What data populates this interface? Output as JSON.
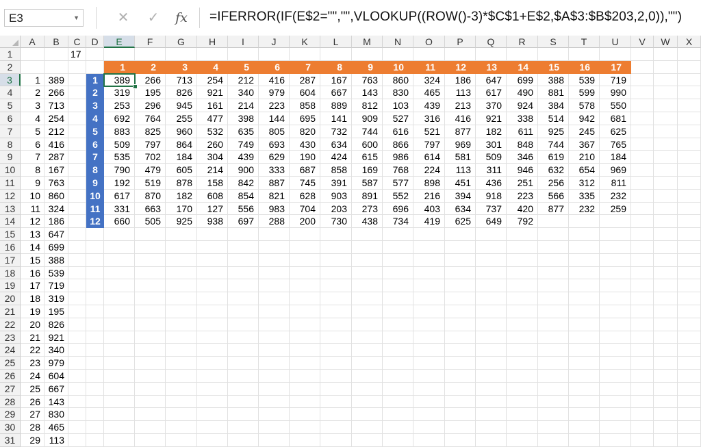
{
  "formula_bar": {
    "name_box": "E3",
    "cancel_icon": "✕",
    "enter_icon": "✓",
    "fx_label": "fx",
    "formula": "=IFERROR(IF(E$2=\"\",\"\",VLOOKUP((ROW()-3)*$C$1+E$2,$A$3:$B$203,2,0)),\"\")"
  },
  "sheet": {
    "columns": [
      "A",
      "B",
      "C",
      "D",
      "E",
      "F",
      "G",
      "H",
      "I",
      "J",
      "K",
      "L",
      "M",
      "N",
      "O",
      "P",
      "Q",
      "R",
      "S",
      "T",
      "U",
      "V",
      "W",
      "X"
    ],
    "rows": [
      1,
      2,
      3,
      4,
      5,
      6,
      7,
      8,
      9,
      10,
      11,
      12,
      13,
      14,
      15,
      16,
      17,
      18,
      19,
      20,
      21,
      22,
      23,
      24,
      25,
      26,
      27,
      28,
      29,
      30,
      31
    ],
    "selected_cell": "E3",
    "c1_value": "17",
    "col_a": [
      1,
      2,
      3,
      4,
      5,
      6,
      7,
      8,
      9,
      10,
      11,
      12,
      13,
      14,
      15,
      16,
      17,
      18,
      19,
      20,
      21,
      22,
      23,
      24,
      25,
      26,
      27,
      28,
      29
    ],
    "col_b": [
      389,
      266,
      713,
      254,
      212,
      416,
      287,
      167,
      763,
      860,
      324,
      186,
      647,
      699,
      388,
      539,
      719,
      319,
      195,
      826,
      921,
      340,
      979,
      604,
      667,
      143,
      830,
      465,
      113
    ],
    "header_row": [
      1,
      2,
      3,
      4,
      5,
      6,
      7,
      8,
      9,
      10,
      11,
      12,
      13,
      14,
      15,
      16,
      17
    ],
    "row_index": [
      1,
      2,
      3,
      4,
      5,
      6,
      7,
      8,
      9,
      10,
      11,
      12
    ],
    "matrix": [
      [
        389,
        266,
        713,
        254,
        212,
        416,
        287,
        167,
        763,
        860,
        324,
        186,
        647,
        699,
        388,
        539,
        719
      ],
      [
        319,
        195,
        826,
        921,
        340,
        979,
        604,
        667,
        143,
        830,
        465,
        113,
        617,
        490,
        881,
        599,
        990
      ],
      [
        253,
        296,
        945,
        161,
        214,
        223,
        858,
        889,
        812,
        103,
        439,
        213,
        370,
        924,
        384,
        578,
        550
      ],
      [
        692,
        764,
        255,
        477,
        398,
        144,
        695,
        141,
        909,
        527,
        316,
        416,
        921,
        338,
        514,
        942,
        681
      ],
      [
        883,
        825,
        960,
        532,
        635,
        805,
        820,
        732,
        744,
        616,
        521,
        877,
        182,
        611,
        925,
        245,
        625
      ],
      [
        509,
        797,
        864,
        260,
        749,
        693,
        430,
        634,
        600,
        866,
        797,
        969,
        301,
        848,
        744,
        367,
        765
      ],
      [
        535,
        702,
        184,
        304,
        439,
        629,
        190,
        424,
        615,
        986,
        614,
        581,
        509,
        346,
        619,
        210,
        184
      ],
      [
        790,
        479,
        605,
        214,
        900,
        333,
        687,
        858,
        169,
        768,
        224,
        113,
        311,
        946,
        632,
        654,
        969
      ],
      [
        192,
        519,
        878,
        158,
        842,
        887,
        745,
        391,
        587,
        577,
        898,
        451,
        436,
        251,
        256,
        312,
        811
      ],
      [
        617,
        870,
        182,
        608,
        854,
        821,
        628,
        903,
        891,
        552,
        216,
        394,
        918,
        223,
        566,
        335,
        232
      ],
      [
        331,
        663,
        170,
        127,
        556,
        983,
        704,
        203,
        273,
        696,
        403,
        634,
        737,
        420,
        877,
        232,
        259
      ],
      [
        660,
        505,
        925,
        938,
        697,
        288,
        200,
        730,
        438,
        734,
        419,
        625,
        649,
        792,
        "",
        "",
        ""
      ]
    ]
  },
  "colors": {
    "orange_header": "#ed7d31",
    "blue_index": "#4472c4",
    "selection": "#217346"
  }
}
